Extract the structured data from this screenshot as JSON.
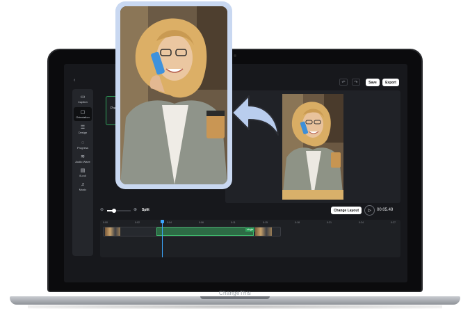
{
  "app": {
    "brand": "ChangeThis"
  },
  "sidebar": {
    "items": [
      {
        "label": "Caption",
        "icon": "caption-icon",
        "glyph": "▭"
      },
      {
        "label": "Orientation",
        "icon": "orientation-icon",
        "glyph": "▢",
        "active": true
      },
      {
        "label": "Design",
        "icon": "design-icon",
        "glyph": "☰"
      },
      {
        "label": "Progress",
        "icon": "progress-icon",
        "glyph": "◌"
      },
      {
        "label": "Audio Wave",
        "icon": "audio-wave-icon",
        "glyph": "≋"
      },
      {
        "label": "B-roll",
        "icon": "b-roll-icon",
        "glyph": "▤"
      },
      {
        "label": "Music",
        "icon": "music-icon",
        "glyph": "♫"
      }
    ]
  },
  "toolbar": {
    "undo_glyph": "↶",
    "redo_glyph": "↷",
    "save_label": "Save",
    "export_label": "Export"
  },
  "orientation": {
    "selected_label": "Port"
  },
  "timeline": {
    "split_label": "Split",
    "change_layout_label": "Change Layout",
    "play_glyph": "▷",
    "time": "00:05.49",
    "zoom_level": 0.3,
    "ticks": [
      "0:00",
      "0:02",
      "0:04",
      "0:06",
      "0:11",
      "0:15",
      "0:18",
      "0:21",
      "0:24",
      "0:27"
    ],
    "clip_tag": "single"
  },
  "colors": {
    "accent_green": "#2fa25b",
    "playhead_blue": "#3ba7ff",
    "card_border": "#c9d8f1",
    "arrow_fill": "#b9cdee"
  }
}
